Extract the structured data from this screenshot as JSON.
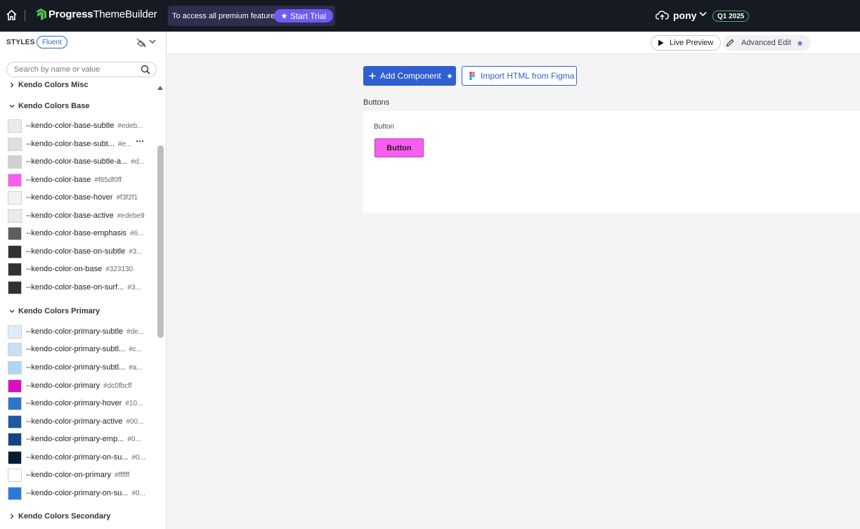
{
  "topbar": {
    "brand": "Progress",
    "product": "ThemeBuilder",
    "premium_text": "To access all premium features",
    "trial_label": "Start Trial",
    "user_name": "pony",
    "version": "Q1 2025"
  },
  "sidebar": {
    "styles_label": "STYLES",
    "theme_badge": "Fluent",
    "search_placeholder": "Search by name or value",
    "groups": [
      {
        "label": "Kendo Colors Misc",
        "expanded": false
      },
      {
        "label": "Kendo Colors Base",
        "expanded": true,
        "items": [
          {
            "name": "--kendo-color-base-subtle",
            "value": "#edeb...",
            "color": "#edebe9"
          },
          {
            "name": "--kendo-color-base-subt...",
            "value": "#e...",
            "color": "#e1dfdd"
          },
          {
            "name": "--kendo-color-base-subtle-a...",
            "value": "#d...",
            "color": "#d2d0ce"
          },
          {
            "name": "--kendo-color-base",
            "value": "#f85df0ff",
            "color": "#f85df0"
          },
          {
            "name": "--kendo-color-base-hover",
            "value": "#f3f2f1",
            "color": "#f3f2f1"
          },
          {
            "name": "--kendo-color-base-active",
            "value": "#edebe9",
            "color": "#edebe9"
          },
          {
            "name": "--kendo-color-base-emphasis",
            "value": "#6...",
            "color": "#605e5c"
          },
          {
            "name": "--kendo-color-base-on-subtle",
            "value": "#3...",
            "color": "#323130"
          },
          {
            "name": "--kendo-color-on-base",
            "value": "#323130",
            "color": "#323130"
          },
          {
            "name": "--kendo-color-base-on-surf...",
            "value": "#3...",
            "color": "#323130"
          }
        ]
      },
      {
        "label": "Kendo Colors Primary",
        "expanded": true,
        "items": [
          {
            "name": "--kendo-color-primary-subtle",
            "value": "#de...",
            "color": "#deecf9"
          },
          {
            "name": "--kendo-color-primary-subtl...",
            "value": "#c...",
            "color": "#c7e0f4"
          },
          {
            "name": "--kendo-color-primary-subtl...",
            "value": "#a...",
            "color": "#b3d5f2"
          },
          {
            "name": "--kendo-color-primary",
            "value": "#dc0fbcff",
            "color": "#dc0fbc"
          },
          {
            "name": "--kendo-color-primary-hover",
            "value": "#10...",
            "color": "#2e74c9"
          },
          {
            "name": "--kendo-color-primary-active",
            "value": "#00...",
            "color": "#1c5aa3"
          },
          {
            "name": "--kendo-color-primary-emp...",
            "value": "#0...",
            "color": "#124584"
          },
          {
            "name": "--kendo-color-primary-on-su...",
            "value": "#0...",
            "color": "#041d33"
          },
          {
            "name": "--kendo-color-on-primary",
            "value": "#ffffff",
            "color": "#ffffff"
          },
          {
            "name": "--kendo-color-primary-on-su...",
            "value": "#0...",
            "color": "#2b7ad9"
          }
        ]
      },
      {
        "label": "Kendo Colors Secondary",
        "expanded": false
      }
    ]
  },
  "toolbar": {
    "live_preview_label": "Live Preview",
    "advanced_edit_label": "Advanced Edit"
  },
  "main": {
    "add_component_label": "Add Component",
    "import_figma_label": "Import HTML from Figma",
    "section_label": "Buttons",
    "card_label": "Button",
    "demo_button_label": "Button"
  },
  "colors": {
    "topbar_bg": "#161a23",
    "accent_purple": "#6d5cf6",
    "primary_blue": "#2f5fd0",
    "brand_green": "#4fc04a",
    "demo_button_bg": "#f85df0"
  }
}
